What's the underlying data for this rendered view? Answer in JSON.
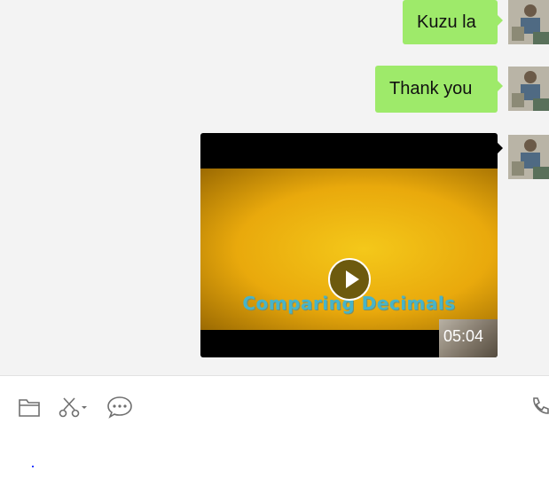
{
  "messages": [
    {
      "text": "Kuzu la"
    },
    {
      "text": "Thank you"
    }
  ],
  "video": {
    "title_text": "Comparing Decimals",
    "duration": "05:04"
  },
  "toolbar": {
    "icons": [
      "folder-icon",
      "scissors-icon",
      "chat-bubble-icon",
      "phone-icon"
    ]
  }
}
